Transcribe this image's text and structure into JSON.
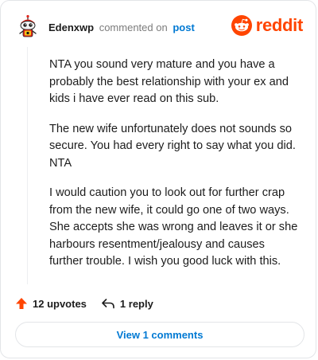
{
  "comment": {
    "username": "Edenxwp",
    "action_text": "commented on",
    "link_text": "post",
    "paragraphs": [
      "NTA you sound very mature and you have a probably the best relationship with your ex and kids i have ever read on this sub.",
      "The new wife unfortunately does not sounds so secure. You had every right to say what you did. NTA",
      "I would caution you to look out for further crap from the new wife, it could go one of two ways. She accepts she was wrong and leaves it or she harbours resentment/jealousy and causes further trouble. I wish you good luck with this."
    ]
  },
  "brand": {
    "wordmark": "reddit",
    "icon": "reddit-logo-icon",
    "color": "#ff4500"
  },
  "actions": {
    "upvotes_label": "12 upvotes",
    "reply_label": "1 reply",
    "upvote_icon": "upvote-arrow-icon",
    "reply_icon": "reply-arrow-icon",
    "upvote_color": "#ff4500"
  },
  "footer": {
    "view_comments_label": "View 1 comments",
    "link_color": "#0079d3"
  }
}
